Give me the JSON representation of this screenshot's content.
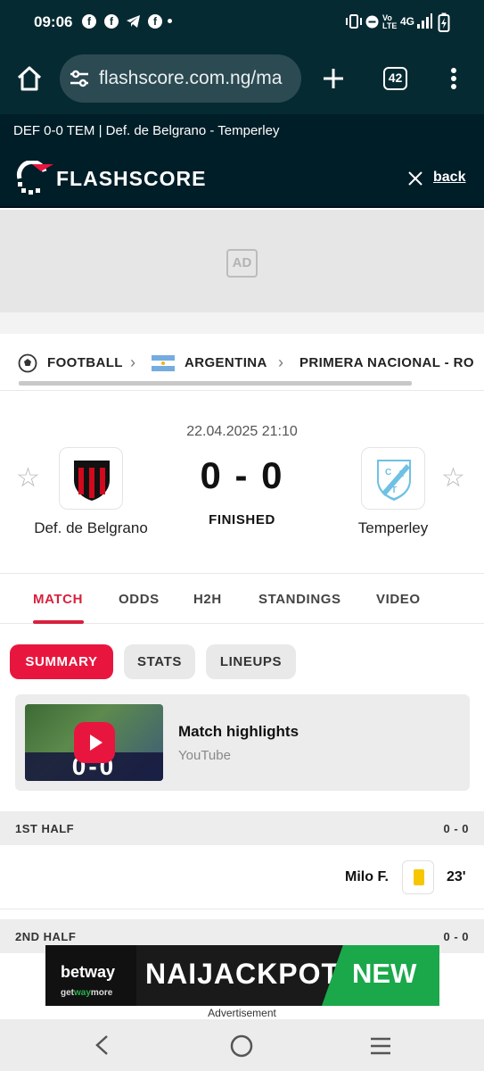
{
  "status_bar": {
    "time": "09:06",
    "network": "4G"
  },
  "browser": {
    "url": "flashscore.com.ng/ma",
    "tab_count": "42"
  },
  "page_title": "DEF 0-0 TEM | Def. de Belgrano - Temperley",
  "header": {
    "logo_text": "FLASHSCORE",
    "back_label": "back"
  },
  "ad": {
    "badge": "AD",
    "label": "Advertisement"
  },
  "breadcrumb": {
    "sport": "FOOTBALL",
    "country": "ARGENTINA",
    "league": "PRIMERA NACIONAL - RO"
  },
  "match": {
    "datetime": "22.04.2025 21:10",
    "home_team": "Def. de Belgrano",
    "away_team": "Temperley",
    "score": "0 - 0",
    "status": "FINISHED",
    "away_logo_letters": "CAT"
  },
  "tabs": [
    "MATCH",
    "ODDS",
    "H2H",
    "STANDINGS",
    "VIDEO"
  ],
  "sub_tabs": [
    "SUMMARY",
    "STATS",
    "LINEUPS"
  ],
  "highlights": {
    "title": "Match highlights",
    "source": "YouTube",
    "thumb_score": "0-0"
  },
  "first_half": {
    "label": "1ST HALF",
    "score": "0 - 0"
  },
  "incident": {
    "player": "Milo F.",
    "minute": "23'"
  },
  "second_half": {
    "label": "2ND HALF",
    "score": "0 - 0"
  },
  "banner": {
    "brand": "betway",
    "tagline_a": "get",
    "tagline_b": "way",
    "tagline_c": "more",
    "headline": "NAIJACKPOT",
    "badge": "NEW"
  },
  "colors": {
    "accent": "#d8213d",
    "header_bg": "#001e28",
    "status_bg": "#062a32",
    "yellow_card": "#f6c700"
  }
}
